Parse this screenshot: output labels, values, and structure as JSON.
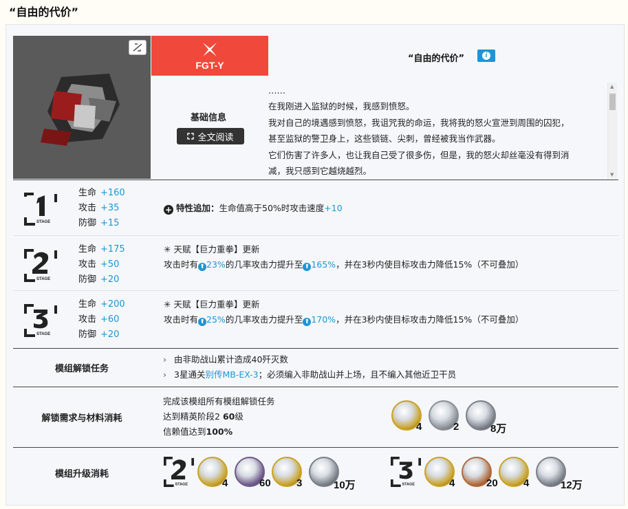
{
  "title": "“自由的代价”",
  "header": {
    "code": "FGT-Y",
    "module_name": "“自由的代价”",
    "basic_info_label": "基础信息",
    "read_full_label": "全文阅读",
    "story_lines": [
      "……",
      "在我刚进入监狱的时候，我感到愤怒。",
      "我对自己的境遇感到愤怒，我诅咒我的命运，我将我的怒火宣泄到周围的囚犯，",
      "甚至监狱的警卫身上，这些锁链、尖刺，曾经被我当作武器。",
      "它们伤害了许多人，也让我自己受了很多伤，但是，我的怒火却丝毫没有得到消",
      "减，我只感到它越烧越烈。"
    ]
  },
  "stages": [
    {
      "stage": "1",
      "stats": [
        {
          "label": "生命",
          "value": "+160"
        },
        {
          "label": "攻击",
          "value": "+35"
        },
        {
          "label": "防御",
          "value": "+15"
        }
      ],
      "effect_title": "特性追加：",
      "effect_text": "生命值高于50%时攻击速度",
      "effect_value": "+10"
    },
    {
      "stage": "2",
      "stats": [
        {
          "label": "生命",
          "value": "+175"
        },
        {
          "label": "攻击",
          "value": "+50"
        },
        {
          "label": "防御",
          "value": "+20"
        }
      ],
      "talent_title": "天赋【巨力重拳】更新",
      "talent_pre": "攻击时有",
      "talent_v1": "23%",
      "talent_mid": "的几率攻击力提升至",
      "talent_v2": "165%",
      "talent_post": "，并在3秒内使目标攻击力降低15%（不可叠加）"
    },
    {
      "stage": "3",
      "stats": [
        {
          "label": "生命",
          "value": "+200"
        },
        {
          "label": "攻击",
          "value": "+60"
        },
        {
          "label": "防御",
          "value": "+20"
        }
      ],
      "talent_title": "天赋【巨力重拳】更新",
      "talent_pre": "攻击时有",
      "talent_v1": "25%",
      "talent_mid": "的几率攻击力提升至",
      "talent_v2": "170%",
      "talent_post": "，并在3秒内使目标攻击力降低15%（不可叠加）"
    }
  ],
  "unlock_tasks": {
    "label": "模组解锁任务",
    "items": [
      {
        "pre": "由非助战山累计造成40歼灭数",
        "link": "",
        "post": ""
      },
      {
        "pre": "3星通关",
        "link": "别传MB-EX-3",
        "post": "；必须编入非助战山并上场，且不编入其他近卫干员"
      }
    ]
  },
  "requirements": {
    "label": "解锁需求与材料消耗",
    "lines": [
      "完成该模组所有模组解锁任务",
      "达到精英阶段2 ",
      "60",
      "级",
      "信赖值达到",
      "100%"
    ],
    "materials": [
      {
        "icon": "module-data-block-icon",
        "count": "4",
        "color": "#c9a227"
      },
      {
        "icon": "crystal-component-icon",
        "count": "2",
        "color": "#8a8f96"
      },
      {
        "icon": "lmd-icon",
        "count": "8万",
        "color": "#7a7f88"
      }
    ]
  },
  "upgrade": {
    "label": "模组升级消耗",
    "groups": [
      {
        "stage": "2",
        "materials": [
          {
            "icon": "module-data-block-icon",
            "count": "4",
            "color": "#c9a227"
          },
          {
            "icon": "orirock-concentration-icon",
            "count": "60",
            "color": "#6f5a8a"
          },
          {
            "icon": "integrated-device-icon",
            "count": "3",
            "color": "#c9a227"
          },
          {
            "icon": "lmd-icon",
            "count": "10万",
            "color": "#7a7f88"
          }
        ]
      },
      {
        "stage": "3",
        "materials": [
          {
            "icon": "module-data-block-icon",
            "count": "4",
            "color": "#c9a227"
          },
          {
            "icon": "manganese-trihydrate-icon",
            "count": "20",
            "color": "#b06a3a"
          },
          {
            "icon": "refined-solvent-icon",
            "count": "4",
            "color": "#c9a227"
          },
          {
            "icon": "lmd-icon",
            "count": "12万",
            "color": "#7a7f88"
          }
        ]
      }
    ]
  }
}
